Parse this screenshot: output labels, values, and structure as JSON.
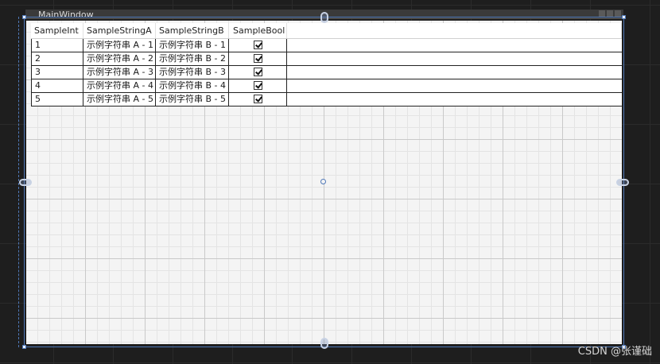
{
  "window": {
    "title": "MainWindow"
  },
  "datagrid": {
    "columns": [
      "SampleInt",
      "SampleStringA",
      "SampleStringB",
      "SampleBool"
    ],
    "rows": [
      {
        "int": "1",
        "a": "示例字符串 A - 1",
        "b": "示例字符串 B - 1",
        "bool": true
      },
      {
        "int": "2",
        "a": "示例字符串 A - 2",
        "b": "示例字符串 B - 2",
        "bool": true
      },
      {
        "int": "3",
        "a": "示例字符串 A - 3",
        "b": "示例字符串 B - 3",
        "bool": true
      },
      {
        "int": "4",
        "a": "示例字符串 A - 4",
        "b": "示例字符串 B - 4",
        "bool": true
      },
      {
        "int": "5",
        "a": "示例字符串 A - 5",
        "b": "示例字符串 B - 5",
        "bool": true
      }
    ]
  },
  "watermark": "CSDN @张谨础",
  "colors": {
    "selection": "#4f78b8",
    "canvas": "#1e1e1e",
    "client": "#f4f4f4"
  }
}
